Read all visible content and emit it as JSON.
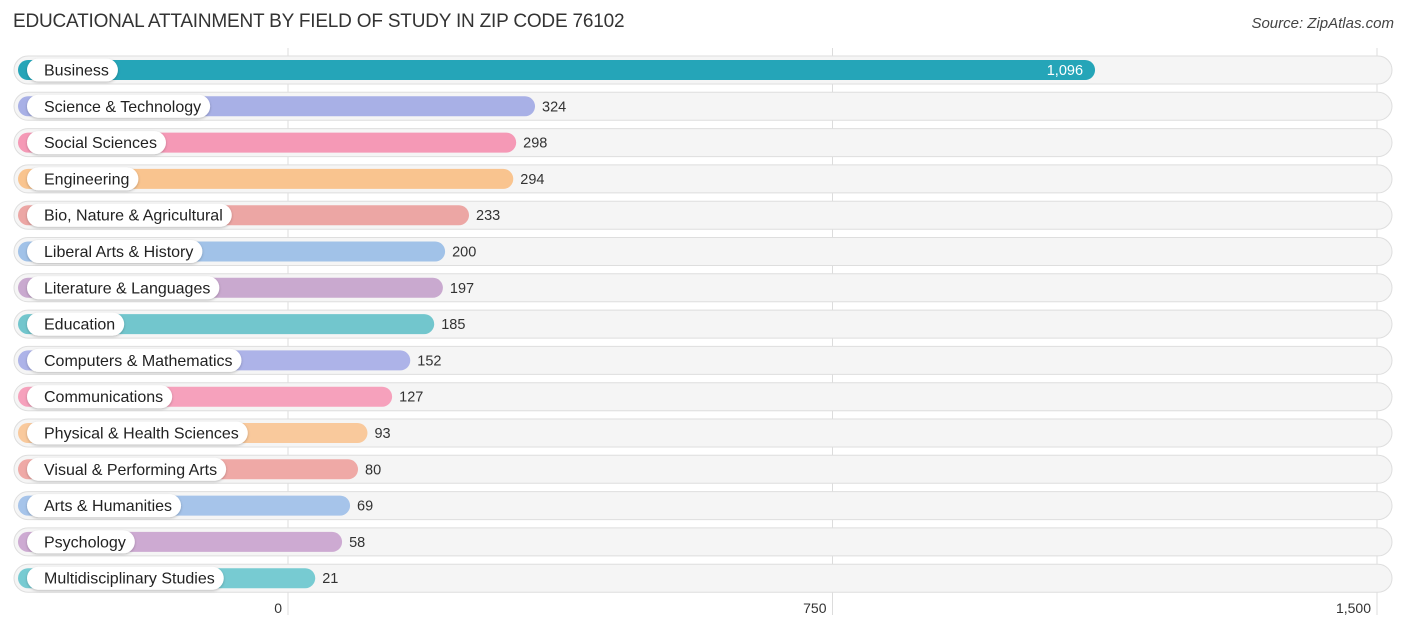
{
  "header": {
    "title": "EDUCATIONAL ATTAINMENT BY FIELD OF STUDY IN ZIP CODE 76102",
    "source": "Source: ZipAtlas.com"
  },
  "chart_data": {
    "type": "bar",
    "orientation": "horizontal",
    "title": "EDUCATIONAL ATTAINMENT BY FIELD OF STUDY IN ZIP CODE 76102",
    "xlabel": "",
    "ylabel": "",
    "xlim": [
      0,
      1500
    ],
    "grid": true,
    "x_ticks": [
      {
        "value": 0,
        "label": "0"
      },
      {
        "value": 750,
        "label": "750"
      },
      {
        "value": 1500,
        "label": "1,500"
      }
    ],
    "categories": [
      "Business",
      "Science & Technology",
      "Social Sciences",
      "Engineering",
      "Bio, Nature & Agricultural",
      "Liberal Arts & History",
      "Literature & Languages",
      "Education",
      "Computers & Mathematics",
      "Communications",
      "Physical & Health Sciences",
      "Visual & Performing Arts",
      "Arts & Humanities",
      "Psychology",
      "Multidisciplinary Studies"
    ],
    "values": [
      1096,
      324,
      298,
      294,
      233,
      200,
      197,
      185,
      152,
      127,
      93,
      80,
      69,
      58,
      21
    ],
    "value_labels": [
      "1,096",
      "324",
      "298",
      "294",
      "233",
      "200",
      "197",
      "185",
      "152",
      "127",
      "93",
      "80",
      "69",
      "58",
      "21"
    ],
    "colors": [
      "#25a5b8",
      "#a8b0e6",
      "#f599b6",
      "#f9c48f",
      "#eca6a4",
      "#a1c2e8",
      "#c9a9cf",
      "#72c6cd",
      "#adb3e8",
      "#f6a1bc",
      "#f9c99c",
      "#efa9a6",
      "#a6c4ea",
      "#cdaad2",
      "#77cbd2"
    ]
  }
}
